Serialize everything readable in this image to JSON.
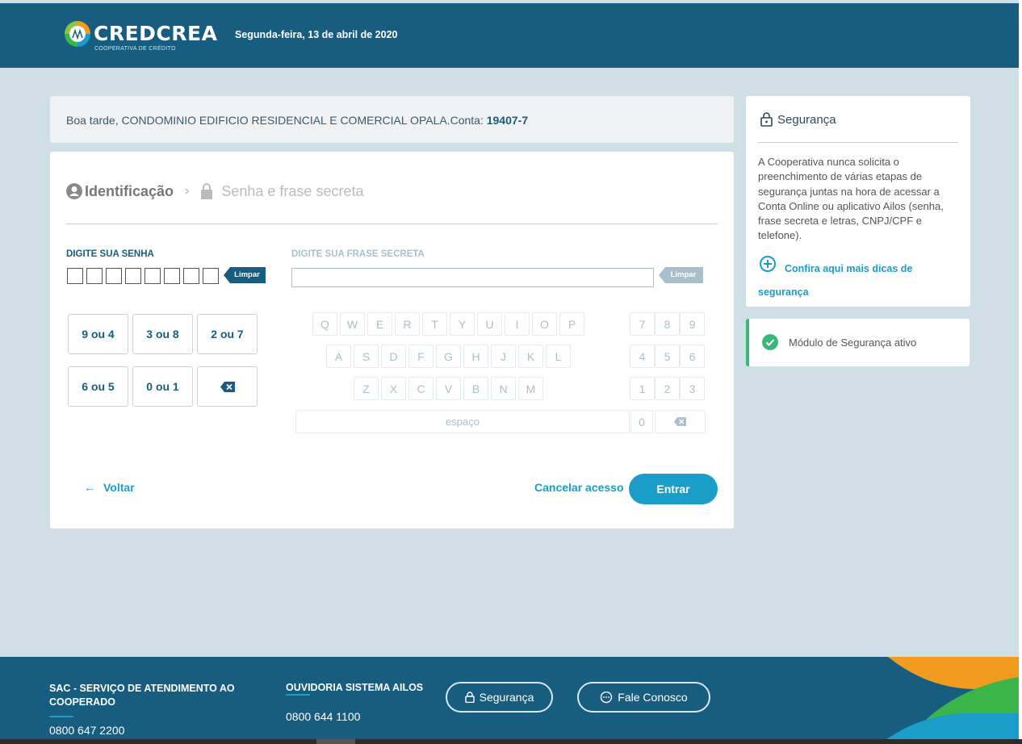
{
  "header": {
    "brand": "CREDCREA",
    "brand_sub": "COOPERATIVA DE CRÉDITO",
    "date": "Segunda-feira, 13 de abril de 2020",
    "logo_icon": "credcrea-logo-icon"
  },
  "greeting": {
    "text": "Boa tarde, CONDOMINIO EDIFICIO RESIDENCIAL E COMERCIAL OPALA.Conta: ",
    "account": "19407-7"
  },
  "steps": {
    "step1": "Identificação",
    "step2": "Senha e frase secreta"
  },
  "password": {
    "label": "DIGITE SUA SENHA",
    "clear_label": "Limpar",
    "boxes": [
      "",
      "",
      "",
      "",
      "",
      "",
      "",
      ""
    ],
    "buttons": [
      {
        "label": "9 ou 4"
      },
      {
        "label": "3 ou 8"
      },
      {
        "label": "2 ou 7"
      },
      {
        "label": "6 ou 5"
      },
      {
        "label": "0 ou 1"
      }
    ]
  },
  "phrase": {
    "label": "DIGITE SUA FRASE SECRETA",
    "clear_label": "Limpar",
    "value": "",
    "row1": [
      "Q",
      "W",
      "E",
      "R",
      "T",
      "Y",
      "U",
      "I",
      "O",
      "P"
    ],
    "row2": [
      "A",
      "S",
      "D",
      "F",
      "G",
      "H",
      "J",
      "K",
      "L"
    ],
    "row3": [
      "Z",
      "X",
      "C",
      "V",
      "B",
      "N",
      "M"
    ],
    "num1": [
      "7",
      "8",
      "9"
    ],
    "num2": [
      "4",
      "5",
      "6"
    ],
    "num3": [
      "1",
      "2",
      "3"
    ],
    "space_label": "espaço",
    "zero": "0"
  },
  "actions": {
    "back": "Voltar",
    "cancel": "Cancelar acesso",
    "enter": "Entrar"
  },
  "security": {
    "title": "Segurança",
    "text": "A Cooperativa nunca solicita o preenchimento de várias etapas de segurança juntas na hora de acessar a Conta Online ou aplicativo Ailos (senha, frase secreta e letras, CNPJ/CPF e telefone).",
    "link": "Confira aqui mais dicas de segurança",
    "module_status": "Módulo de Segurança ativo"
  },
  "footer": {
    "sac_title": "SAC - SERVIÇO DE ATENDIMENTO AO COOPERADO",
    "sac_phone": "0800 647 2200",
    "ouv_title": "OUVIDORIA SISTEMA AILOS",
    "ouv_phone": "0800 644 1100",
    "security_btn": "Segurança",
    "contact_btn": "Fale Conosco"
  },
  "colors": {
    "brand_blue": "#175d80",
    "accent": "#1a9dc8",
    "success": "#38b77a",
    "page_bg": "#d0dfe6"
  }
}
